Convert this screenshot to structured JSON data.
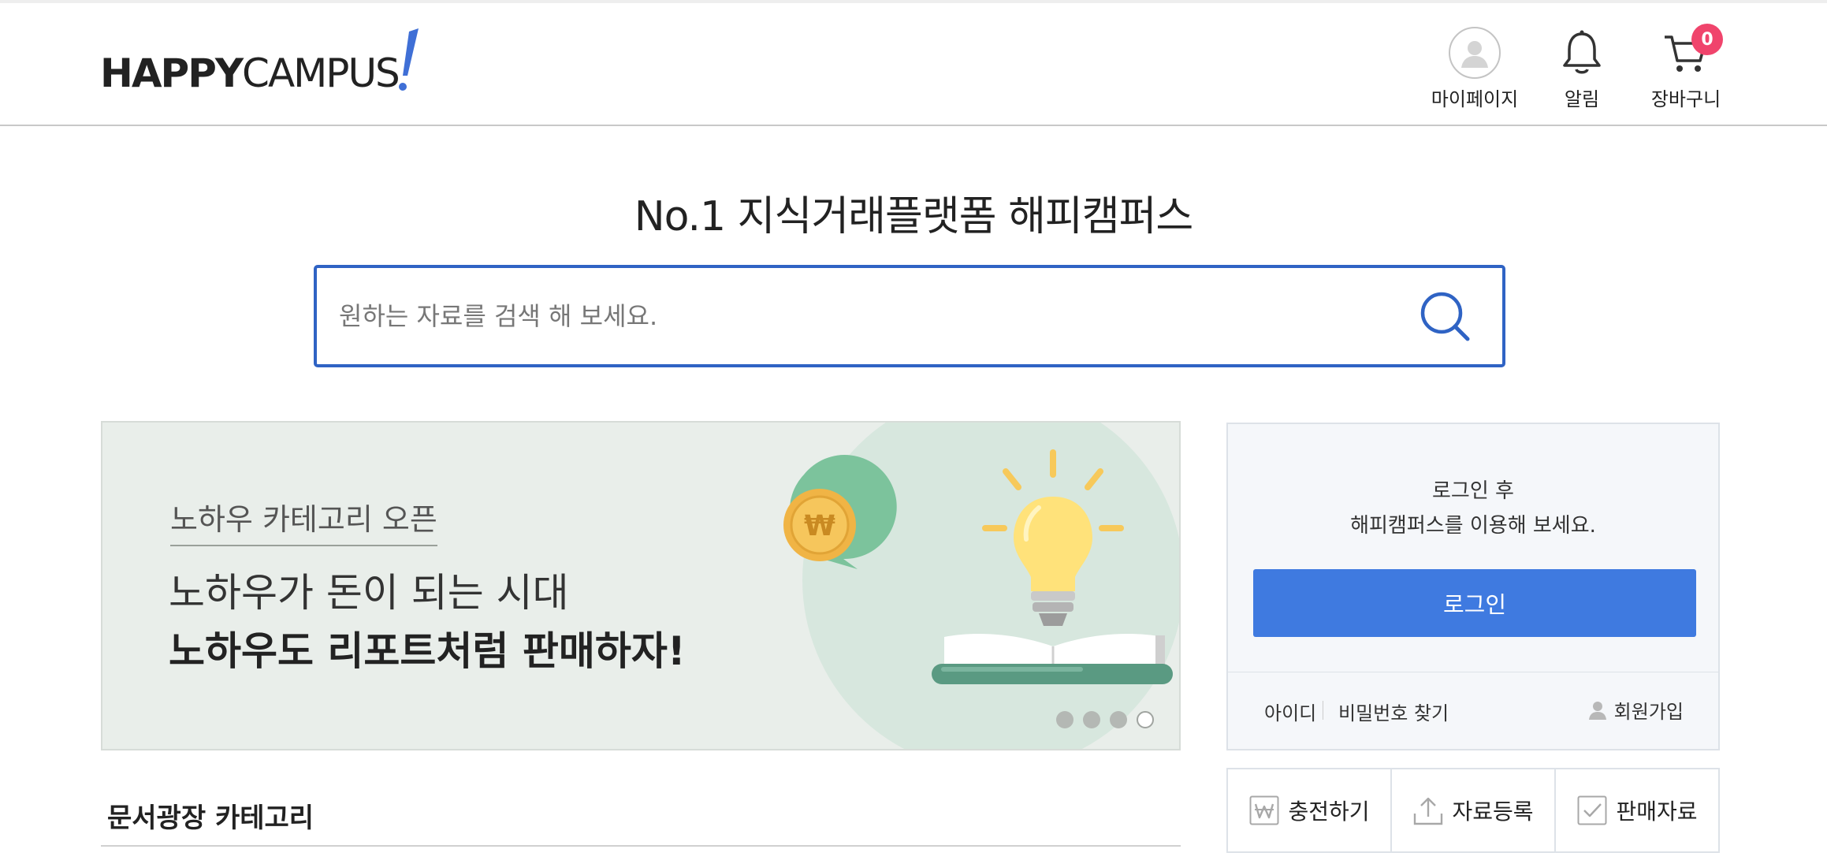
{
  "header": {
    "logo_text_bold": "HAPPY",
    "logo_text_light": "CAMPUS",
    "nav": {
      "mypage_label": "마이페이지",
      "alarm_label": "알림",
      "cart_label": "장바구니",
      "cart_count": "0"
    }
  },
  "hero": {
    "title": "No.1 지식거래플랫폼 해피캠퍼스",
    "search_placeholder": "원하는 자료를 검색 해 보세요."
  },
  "banner": {
    "subtitle": "노하우 카테고리 오픈",
    "line1": "노하우가 돈이 되는 시대",
    "line2": "노하우도 리포트처럼 판매하자!",
    "coin_symbol": "₩",
    "slide_count": 4,
    "active_slide": 4
  },
  "login": {
    "message_line1": "로그인 후",
    "message_line2": "해피캠퍼스를 이용해 보세요.",
    "login_button": "로그인",
    "find_id": "아이디",
    "find_password": "비밀번호 찾기",
    "signup": "회원가입"
  },
  "actions": {
    "charge": "충전하기",
    "upload": "자료등록",
    "sales": "판매자료"
  },
  "category": {
    "title": "문서광장 카테고리"
  },
  "colors": {
    "accent_blue": "#3f7ae0",
    "search_border": "#2f63c4",
    "badge_pink": "#f0446c",
    "banner_bg": "#e9eeea"
  }
}
